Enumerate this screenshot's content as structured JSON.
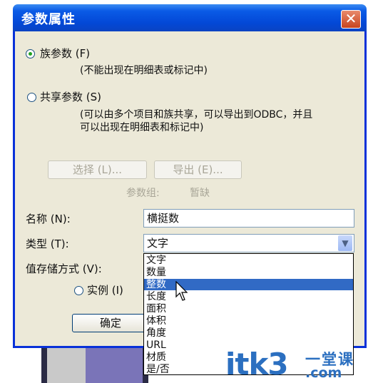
{
  "window": {
    "title": "参数属性",
    "close_glyph": "✕"
  },
  "param_kind": {
    "family_label": "族参数 (F)",
    "family_desc": "(不能出现在明细表或标记中)",
    "shared_label": "共享参数 (S)",
    "shared_desc_line1": "(可以由多个项目和族共享，可以导出到ODBC，并且",
    "shared_desc_line2": "可以出现在明细表和标记中)",
    "selected": "family"
  },
  "buttons": {
    "select_label": "选择 (L)...",
    "export_label": "导出 (E)...",
    "ok_label": "确定"
  },
  "param_group": {
    "label": "参数组:",
    "value": "暂缺"
  },
  "form": {
    "name_label": "名称 (N):",
    "name_value": "横挺数",
    "type_label": "类型 (T):",
    "type_value": "文字",
    "storage_label": "值存储方式 (V):",
    "instance_label": "实例 (I)"
  },
  "type_options": [
    "文字",
    "数量",
    "整数",
    "长度",
    "面积",
    "体积",
    "角度",
    "URL",
    "材质",
    "是/否"
  ],
  "type_highlighted": "整数",
  "icons": {
    "dropdown": "chevron-down-icon",
    "cursor": "mouse-pointer-icon"
  },
  "watermark": {
    "brand": "itk3",
    "tagline_top": "一堂课",
    "tagline_bottom": ".com"
  }
}
